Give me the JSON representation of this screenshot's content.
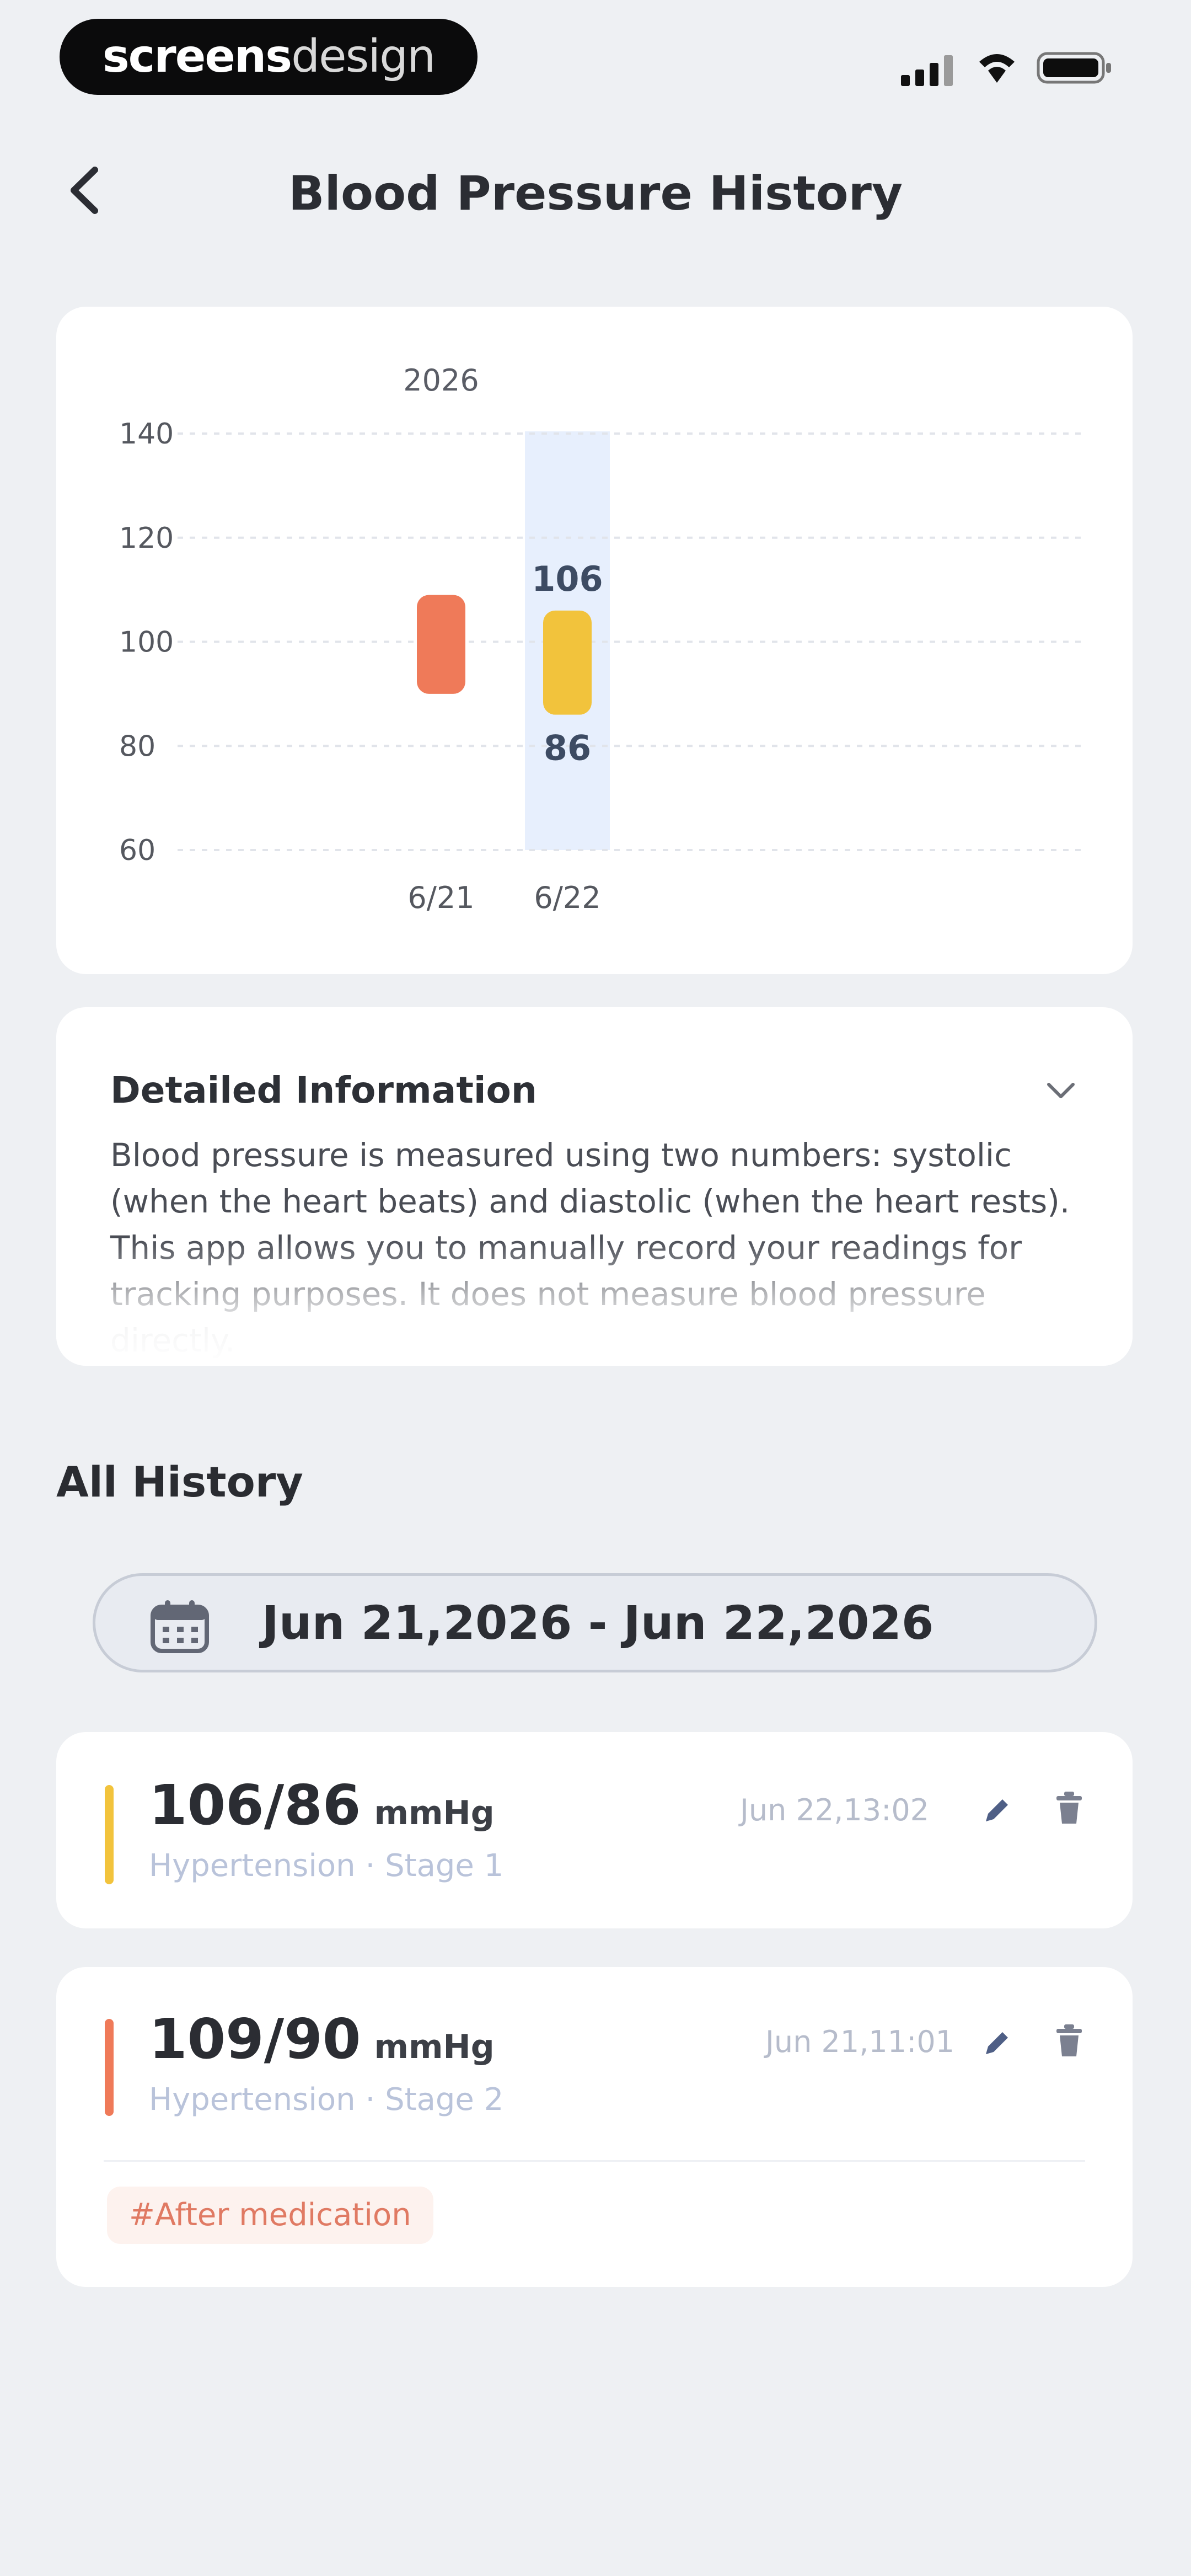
{
  "status_bar": {
    "brand_bold": "screens",
    "brand_light": "design"
  },
  "header": {
    "title": "Blood Pressure History"
  },
  "chart_data": {
    "type": "bar",
    "subtype": "floating-range",
    "year_label": "2026",
    "categories": [
      "6/21",
      "6/22"
    ],
    "series": [
      {
        "values": [
          [
            90,
            109
          ],
          [
            86,
            106
          ]
        ]
      }
    ],
    "bar_colors": [
      "#ef7a59",
      "#f2c33c"
    ],
    "selected_category": "6/22",
    "selected_labels": {
      "high": "106",
      "low": "86"
    },
    "y_ticks": [
      140,
      120,
      100,
      80,
      60
    ],
    "ylim": [
      60,
      140
    ],
    "grid": true
  },
  "info": {
    "title": "Detailed Information",
    "text": "Blood pressure is measured using two numbers: systolic (when the heart beats) and diastolic (when the heart rests). This app allows you to manually record your readings for tracking purposes. It does not measure blood pressure directly."
  },
  "history": {
    "title": "All History",
    "range": "Jun 21,2026 - Jun 22,2026",
    "records": [
      {
        "reading": "106/86",
        "unit": "mmHg",
        "stage": "Hypertension · Stage 1",
        "time": "Jun 22,13:02",
        "accent": "#f2c33c"
      },
      {
        "reading": "109/90",
        "unit": "mmHg",
        "stage": "Hypertension · Stage 2",
        "time": "Jun 21,11:01",
        "accent": "#ef7a59",
        "tag": "#After medication"
      }
    ]
  },
  "colors": {
    "background": "#eef0f3",
    "card": "#ffffff",
    "highlight_column": "#e7effd",
    "stage_text": "#b9c3da"
  }
}
